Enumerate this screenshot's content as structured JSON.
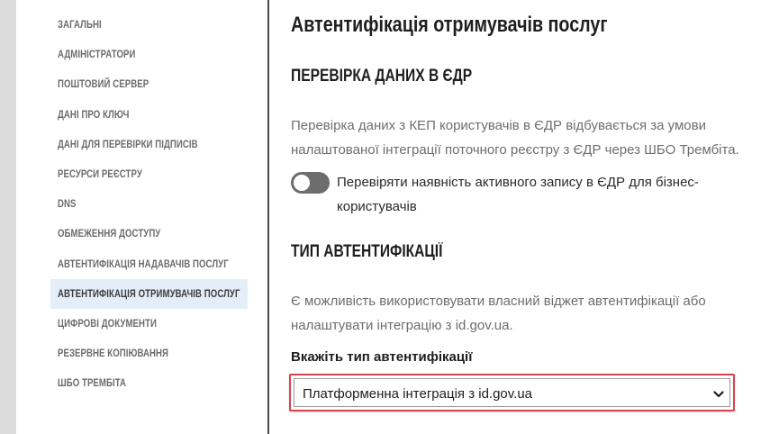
{
  "sidebar": {
    "items": [
      {
        "label": "ЗАГАЛЬНІ",
        "active": false
      },
      {
        "label": "АДМІНІСТРАТОРИ",
        "active": false
      },
      {
        "label": "ПОШТОВИЙ СЕРВЕР",
        "active": false
      },
      {
        "label": "ДАНІ ПРО КЛЮЧ",
        "active": false
      },
      {
        "label": "ДАНІ ДЛЯ ПЕРЕВІРКИ ПІДПИСІВ",
        "active": false
      },
      {
        "label": "РЕСУРСИ РЕЄСТРУ",
        "active": false
      },
      {
        "label": "DNS",
        "active": false
      },
      {
        "label": "ОБМЕЖЕННЯ ДОСТУПУ",
        "active": false
      },
      {
        "label": "АВТЕНТИФІКАЦІЯ НАДАВАЧІВ ПОСЛУГ",
        "active": false
      },
      {
        "label": "АВТЕНТИФІКАЦІЯ ОТРИМУВАЧІВ ПОСЛУГ",
        "active": true
      },
      {
        "label": "ЦИФРОВІ ДОКУМЕНТИ",
        "active": false
      },
      {
        "label": "РЕЗЕРВНЕ КОПІЮВАННЯ",
        "active": false
      },
      {
        "label": "ШБО ТРЕМБІТА",
        "active": false
      }
    ]
  },
  "main": {
    "title": "Автентифікація отримувачів послуг",
    "edr_section": {
      "title": "ПЕРЕВІРКА ДАНИХ В ЄДР",
      "description": "Перевірка даних з КЕП користувачів в ЄДР відбувається за умови налаштованої інтеграції поточного реєстру з ЄДР через ШБО Трембіта.",
      "toggle_label": "Перевіряти наявність активного запису в ЄДР для бізнес-користувачів",
      "toggle_on": false
    },
    "auth_section": {
      "title": "ТИП АВТЕНТИФІКАЦІЇ",
      "description": "Є можливість використовувати власний віджет автентифікації або налаштувати інтеграцію з id.gov.ua.",
      "field_label": "Вкажіть тип автентифікації",
      "select_value": "Платформенна інтеграція з id.gov.ua"
    }
  },
  "colors": {
    "active_nav_bg": "#e3eef9",
    "highlight_border": "#d9434e",
    "toggle_off": "#6d6d6d"
  }
}
